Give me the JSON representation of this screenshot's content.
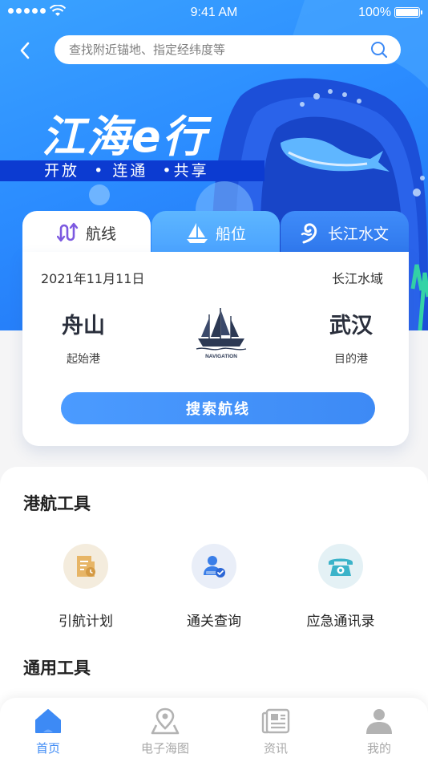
{
  "status_bar": {
    "time": "9:41 AM",
    "battery": "100%"
  },
  "search": {
    "placeholder": "查找附近锚地、指定经纬度等"
  },
  "hero": {
    "brand": "江海e行",
    "slogan": "开放  • 连通  •共享"
  },
  "tabs": [
    {
      "label": "航线",
      "icon": "route-icon",
      "active": true
    },
    {
      "label": "船位",
      "icon": "sailboat-icon",
      "active": false
    },
    {
      "label": "长江水文",
      "icon": "wave-icon",
      "active": false
    }
  ],
  "route": {
    "date": "2021年11月11日",
    "region": "长江水域",
    "start_port": "舟山",
    "start_label": "起始港",
    "end_port": "武汉",
    "end_label": "目的港",
    "logo_text": "NAVIGATION",
    "search_button": "搜索航线"
  },
  "sections": {
    "port_tools_title": "港航工具",
    "general_tools_title": "通用工具"
  },
  "port_tools": [
    {
      "label": "引航计划",
      "icon": "document-clock-icon",
      "color": "#f3ead9"
    },
    {
      "label": "通关查询",
      "icon": "user-check-icon",
      "color": "#e8edf7"
    },
    {
      "label": "应急通讯录",
      "icon": "telephone-icon",
      "color": "#e3f0f4"
    }
  ],
  "bottom_nav": [
    {
      "label": "首页",
      "icon": "home-icon",
      "active": true
    },
    {
      "label": "电子海图",
      "icon": "map-pin-icon",
      "active": false
    },
    {
      "label": "资讯",
      "icon": "newspaper-icon",
      "active": false
    },
    {
      "label": "我的",
      "icon": "person-icon",
      "active": false
    }
  ],
  "colors": {
    "primary": "#3d8af5",
    "hero_dark": "#0c3bd1"
  }
}
